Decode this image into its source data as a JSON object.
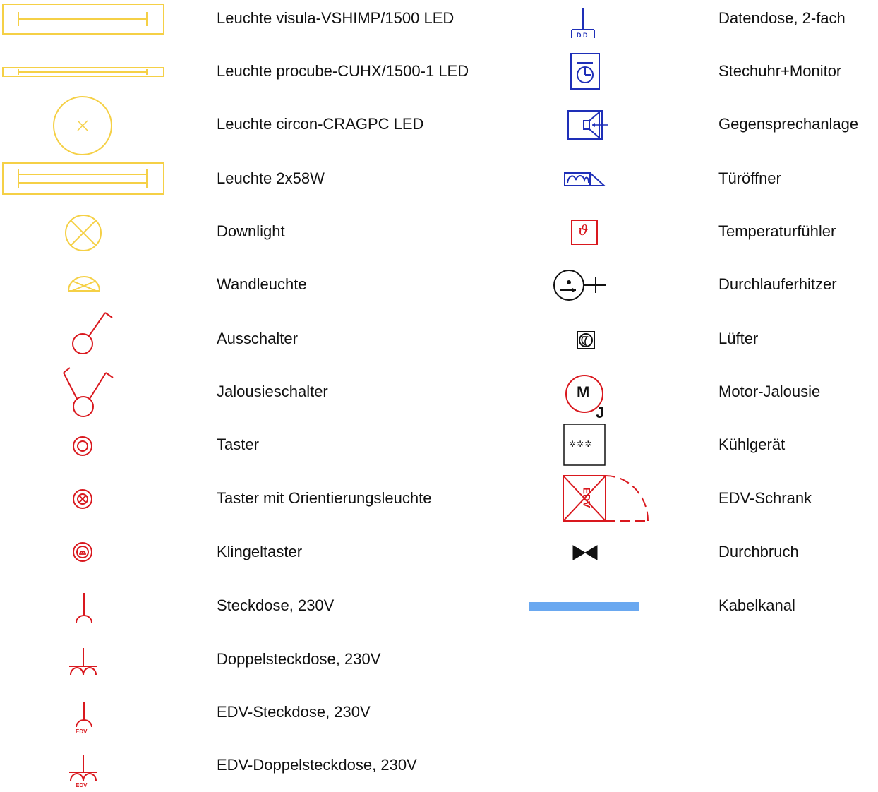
{
  "colors": {
    "light": "#F5D046",
    "power": "#D9181E",
    "low_voltage": "#1E2FB8",
    "neutral": "#111111",
    "cable": "#6AA8F0"
  },
  "left": [
    {
      "label": "Leuchte visula-VSHIMP/1500 LED",
      "icon": "linear-luminaire-icon"
    },
    {
      "label": "Leuchte procube-CUHX/1500-1 LED",
      "icon": "slim-linear-luminaire-icon"
    },
    {
      "label": "Leuchte circon-CRAGPC LED",
      "icon": "round-luminaire-icon"
    },
    {
      "label": "Leuchte 2x58W",
      "icon": "twin-tube-luminaire-icon"
    },
    {
      "label": "Downlight",
      "icon": "downlight-icon"
    },
    {
      "label": "Wandleuchte",
      "icon": "wall-light-icon"
    },
    {
      "label": "Ausschalter",
      "icon": "switch-icon"
    },
    {
      "label": "Jalousieschalter",
      "icon": "blind-switch-icon"
    },
    {
      "label": "Taster",
      "icon": "push-button-icon"
    },
    {
      "label": "Taster mit Orientierungsleuchte",
      "icon": "illuminated-push-button-icon"
    },
    {
      "label": "Klingeltaster",
      "icon": "bell-push-icon"
    },
    {
      "label": "Steckdose, 230V",
      "icon": "socket-icon"
    },
    {
      "label": "Doppelsteckdose, 230V",
      "icon": "double-socket-icon"
    },
    {
      "label": "EDV-Steckdose, 230V",
      "icon": "it-socket-icon",
      "tag": "EDV"
    },
    {
      "label": "EDV-Doppelsteckdose, 230V",
      "icon": "it-double-socket-icon",
      "tag": "EDV"
    }
  ],
  "right": [
    {
      "label": "Datendose, 2-fach",
      "icon": "data-outlet-icon",
      "tag": "D D"
    },
    {
      "label": "Stechuhr+Monitor",
      "icon": "time-clock-icon"
    },
    {
      "label": "Gegensprechanlage",
      "icon": "intercom-icon"
    },
    {
      "label": "Türöffner",
      "icon": "door-opener-icon"
    },
    {
      "label": "Temperaturfühler",
      "icon": "temperature-sensor-icon",
      "glyph": "ϑ"
    },
    {
      "label": "Durchlauferhitzer",
      "icon": "water-heater-icon"
    },
    {
      "label": "Lüfter",
      "icon": "fan-icon"
    },
    {
      "label": "Motor-Jalousie",
      "icon": "motor-blind-icon",
      "glyph": "M",
      "glyph2": "J"
    },
    {
      "label": "Kühlgerät",
      "icon": "refrigerator-icon",
      "glyph": "✲✲✲"
    },
    {
      "label": "EDV-Schrank",
      "icon": "it-cabinet-icon",
      "tag": "EDV"
    },
    {
      "label": "Durchbruch",
      "icon": "wall-opening-icon"
    },
    {
      "label": "Kabelkanal",
      "icon": "cable-duct-icon"
    }
  ]
}
